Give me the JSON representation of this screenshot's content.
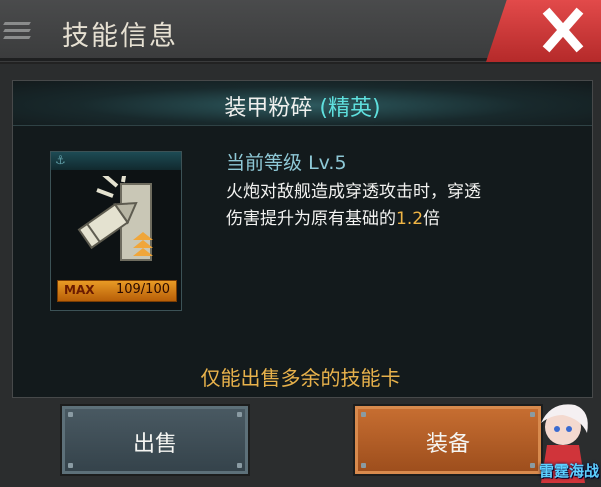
{
  "header": {
    "title": "技能信息"
  },
  "skill": {
    "name": "装甲粉碎",
    "rank": "(精英)",
    "level_label": "当前等级",
    "level_value": "Lv.5",
    "desc_part1": "火炮对敌舰造成穿透攻击时，穿透",
    "desc_part2": "伤害提升为原有基础的",
    "desc_value": "1.2",
    "desc_part3": "倍",
    "max_tag": "MAX",
    "progress": "109/100"
  },
  "note": "仅能出售多余的技能卡",
  "buttons": {
    "sell": "出售",
    "equip": "装备"
  },
  "watermark": "雷霆海战",
  "colors": {
    "accent": "#5fe0de",
    "highlight": "#f0b545",
    "sell_note": "#e8b24b",
    "close": "#d33b3b",
    "equip": "#b55f27"
  }
}
